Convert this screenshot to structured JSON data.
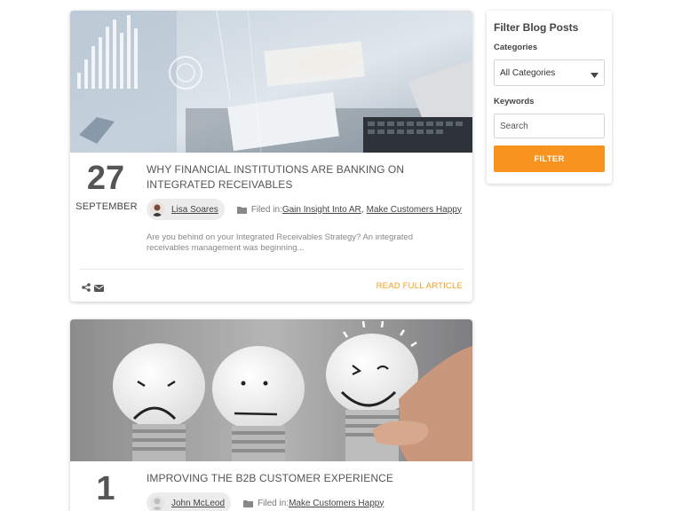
{
  "posts": [
    {
      "day": "27",
      "month": "SEPTEMBER",
      "title": "WHY FINANCIAL INSTITUTIONS ARE BANKING ON INTEGRATED RECEIVABLES",
      "author": "Lisa Soares",
      "filed_label": "Filed in:",
      "categories": [
        "Gain Insight Into AR",
        "Make Customers Happy"
      ],
      "excerpt": "Are you behind on your Integrated Receivables Strategy? An integrated receivables management was beginning...",
      "read_more": "READ FULL ARTICLE",
      "image_alt": "business-analytics-desk-photo"
    },
    {
      "day": "1",
      "title": "IMPROVING THE B2B CUSTOMER EXPERIENCE",
      "author": "John McLeod",
      "filed_label": "Filed in:",
      "categories": [
        "Make Customers Happy"
      ],
      "image_alt": "lightbulb-faces-photo"
    }
  ],
  "sidebar": {
    "title": "Filter Blog Posts",
    "categories_label": "Categories",
    "categories_selected": "All Categories",
    "keywords_label": "Keywords",
    "search_placeholder": "Search",
    "filter_button": "FILTER"
  },
  "colors": {
    "accent": "#f7931e",
    "link_orange": "#f59c1a"
  }
}
